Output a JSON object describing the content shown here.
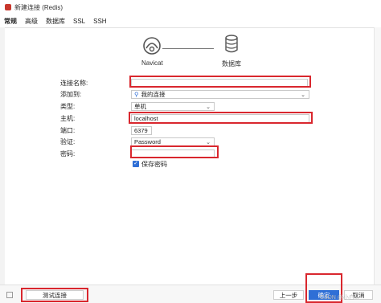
{
  "window": {
    "title": "新建连接 (Redis)"
  },
  "tabs": [
    {
      "label": "常规"
    },
    {
      "label": "高级"
    },
    {
      "label": "数据库"
    },
    {
      "label": "SSL"
    },
    {
      "label": "SSH"
    }
  ],
  "illustration": {
    "left_label": "Navicat",
    "right_label": "数据库"
  },
  "form": {
    "connection_name": {
      "label": "连接名称:",
      "value": ""
    },
    "add_to": {
      "label": "添加到:",
      "value": "我的连接"
    },
    "type": {
      "label": "类型:",
      "value": "单机"
    },
    "host": {
      "label": "主机:",
      "value": "localhost"
    },
    "port": {
      "label": "端口:",
      "value": "6379"
    },
    "auth": {
      "label": "验证:",
      "value": "Password"
    },
    "password": {
      "label": "密码:",
      "value": ""
    },
    "save_password": {
      "label": "保存密码",
      "checked": true
    }
  },
  "buttons": {
    "test": "测试连接",
    "prev": "上一步",
    "ok": "确定",
    "cancel": "取消"
  },
  "watermark": "CSDN @小白..."
}
